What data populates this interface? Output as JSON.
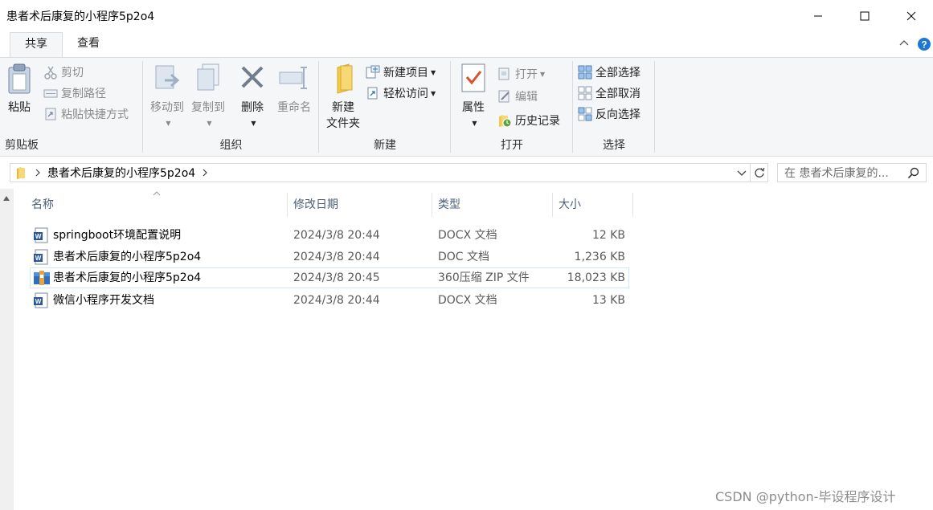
{
  "window": {
    "title": "患者术后康复的小程序5p2o4",
    "minimize_glyph": "—",
    "close_glyph": "✕"
  },
  "tabs": [
    {
      "label": "共享",
      "active": true
    },
    {
      "label": "查看",
      "active": false
    }
  ],
  "ribbon": {
    "clipboard": {
      "label": "剪贴板",
      "paste": "粘贴",
      "cut": "剪切",
      "copy_path": "复制路径",
      "paste_shortcut": "粘贴快捷方式"
    },
    "organize": {
      "label": "组织",
      "move_to": "移动到",
      "copy_to": "复制到",
      "delete": "删除",
      "rename": "重命名"
    },
    "new": {
      "label": "新建",
      "new_folder_line1": "新建",
      "new_folder_line2": "文件夹",
      "new_item": "新建项目",
      "easy_access": "轻松访问"
    },
    "open": {
      "label": "打开",
      "properties": "属性",
      "open": "打开",
      "edit": "编辑",
      "history": "历史记录"
    },
    "select": {
      "label": "选择",
      "select_all": "全部选择",
      "select_none": "全部取消",
      "invert": "反向选择"
    }
  },
  "address": {
    "path": "患者术后康复的小程序5p2o4",
    "search_placeholder": "在 患者术后康复的..."
  },
  "columns": {
    "name": "名称",
    "date": "修改日期",
    "type": "类型",
    "size": "大小"
  },
  "files": [
    {
      "name": "springboot环境配置说明",
      "date": "2024/3/8 20:44",
      "type": "DOCX 文档",
      "size": "12 KB",
      "icon": "word-doc-icon"
    },
    {
      "name": "患者术后康复的小程序5p2o4",
      "date": "2024/3/8 20:44",
      "type": "DOC 文档",
      "size": "1,236 KB",
      "icon": "word-doc-icon"
    },
    {
      "name": "患者术后康复的小程序5p2o4",
      "date": "2024/3/8 20:45",
      "type": "360压缩 ZIP 文件",
      "size": "18,023 KB",
      "icon": "zip-archive-icon"
    },
    {
      "name": "微信小程序开发文档",
      "date": "2024/3/8 20:44",
      "type": "DOCX 文档",
      "size": "13 KB",
      "icon": "word-doc-icon"
    }
  ],
  "watermark": "CSDN @python-毕设程序设计",
  "colors": {
    "accent": "#0063b1",
    "ribbon_bg": "#f5f6f7",
    "header_text": "#4c607a",
    "word_blue": "#2b579a",
    "folder_yellow": "#f8d775"
  }
}
